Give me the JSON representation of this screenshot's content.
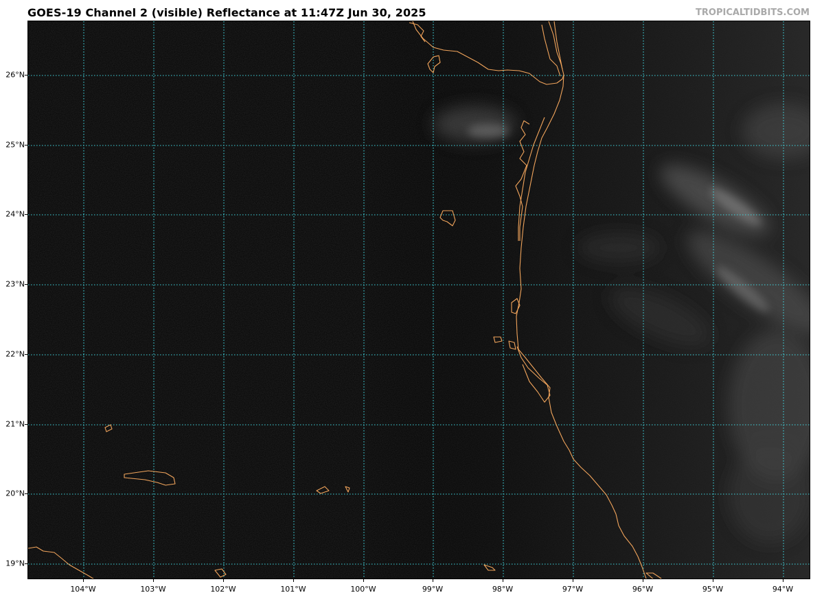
{
  "title": "GOES-19 Channel 2 (visible) Reflectance at 11:47Z Jun 30, 2025",
  "brand": "TROPICALTIDBITS.COM",
  "colors": {
    "background": "#030303",
    "gridline": "#3fd6e0",
    "coastline": "#f2a55c",
    "cloud": "#9a9a9a"
  },
  "grid_style": "dotted",
  "lat_labels": [
    "26°N",
    "25°N",
    "24°N",
    "23°N",
    "22°N",
    "21°N",
    "20°N",
    "19°N"
  ],
  "lon_labels": [
    "104°W",
    "103°W",
    "102°W",
    "101°W",
    "100°W",
    "99°W",
    "98°W",
    "97°W",
    "96°W",
    "95°W",
    "94°W"
  ]
}
